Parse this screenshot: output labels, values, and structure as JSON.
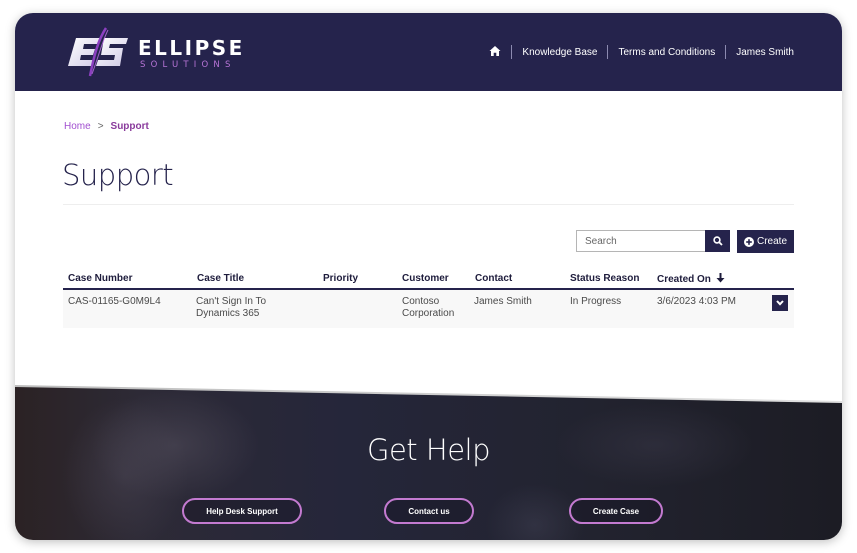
{
  "brand": {
    "name": "ELLIPSE",
    "tagline": "SOLUTIONS",
    "colors": {
      "primary": "#25234c",
      "accent": "#a14fd0",
      "button_border": "#c37ad0"
    }
  },
  "nav": {
    "home_icon": "home-icon",
    "items": [
      {
        "label": "Knowledge Base"
      },
      {
        "label": "Terms and Conditions"
      },
      {
        "label": "James Smith"
      }
    ]
  },
  "breadcrumb": {
    "home": "Home",
    "separator": ">",
    "current": "Support"
  },
  "page": {
    "title": "Support"
  },
  "toolbar": {
    "search_placeholder": "Search",
    "search_icon": "search-icon",
    "create_label": "Create",
    "create_icon": "plus-circle-icon"
  },
  "table": {
    "columns": [
      {
        "label": "Case Number"
      },
      {
        "label": "Case Title"
      },
      {
        "label": "Priority"
      },
      {
        "label": "Customer"
      },
      {
        "label": "Contact"
      },
      {
        "label": "Status Reason"
      },
      {
        "label": "Created On",
        "sort": "descending"
      }
    ],
    "rows": [
      {
        "case_number": "CAS-01165-G0M9L4",
        "case_title_line1": "Can't Sign In To",
        "case_title_line2": "Dynamics 365",
        "priority": "",
        "customer_line1": "Contoso",
        "customer_line2": "Corporation",
        "contact": "James Smith",
        "status_reason": "In Progress",
        "created_on": "3/6/2023 4:03 PM"
      }
    ]
  },
  "footer": {
    "title": "Get Help",
    "buttons": [
      {
        "label": "Help Desk Support"
      },
      {
        "label": "Contact us"
      },
      {
        "label": "Create Case"
      }
    ]
  }
}
